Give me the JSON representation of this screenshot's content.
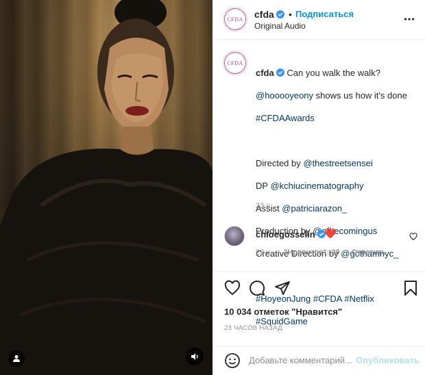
{
  "post": {
    "username": "cfda",
    "avatar_logo_text": "CFDA",
    "follow_label": "Подписаться",
    "dot": "•",
    "audio": "Original Audio",
    "caption": {
      "intro": "Can you walk the walk?",
      "mention_lead": "@hooooyeony",
      "line2_rest": " shows us how it's done",
      "hashtag_awards": "#CFDAAwards",
      "directed_prefix": "Directed by ",
      "directed_by": "@thestreetsensei",
      "dp_prefix": "DP ",
      "dp": "@kchiucinematography",
      "assist_prefix": "Assist ",
      "assist": "@patriciarazon_",
      "production_prefix": "Production by ",
      "production": "@ofbecomingus",
      "creative_prefix": "Creative Direction by ",
      "creative": "@gothamnyc_",
      "tag1": "#HoyeonJung",
      "tag2": "#CFDA",
      "tag3": "#Netflix",
      "tag4": "#SquidGame"
    },
    "caption_time": "23 ч.",
    "comment": {
      "username": "chloegosselin",
      "emoji": "❤️",
      "time": "22 ч.",
      "likes": "\"Нравится\": 20",
      "reply": "Ответить"
    },
    "likes_count": "10 034 отметок \"Нравится\"",
    "posted_ago": "23 ЧАСОВ НАЗАД",
    "add_comment_placeholder": "Добавьте комментарий...",
    "publish_label": "Опубликовать"
  },
  "icons": {
    "user_tag": "user-icon",
    "sound": "speaker-icon",
    "verified": "verified-badge-icon",
    "more": "more-horizontal-icon",
    "like": "heart-icon",
    "comment": "comment-bubble-icon",
    "share": "paper-plane-icon",
    "save": "bookmark-icon",
    "emoji": "smiley-icon"
  },
  "colors": {
    "link": "#00376b",
    "accent": "#0095f6",
    "publish_disabled": "#b2dffc",
    "muted": "#8e8e8e",
    "brand_ring": "#d9478b"
  }
}
